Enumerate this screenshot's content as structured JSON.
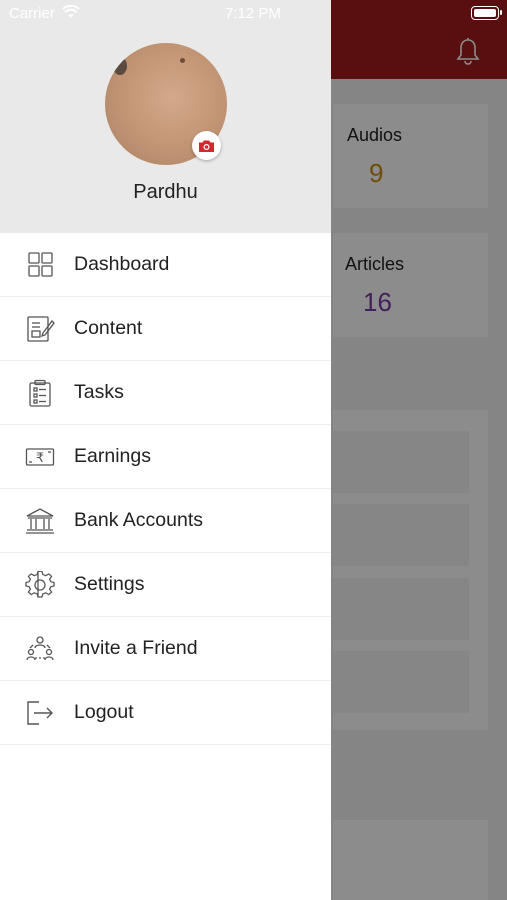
{
  "status_bar": {
    "carrier": "Carrier",
    "time": "7:12 PM"
  },
  "drawer": {
    "user_name": "Pardhu",
    "items": [
      {
        "label": "Dashboard",
        "icon": "dashboard-icon"
      },
      {
        "label": "Content",
        "icon": "content-icon"
      },
      {
        "label": "Tasks",
        "icon": "tasks-icon"
      },
      {
        "label": "Earnings",
        "icon": "earnings-icon"
      },
      {
        "label": "Bank Accounts",
        "icon": "bank-icon"
      },
      {
        "label": "Settings",
        "icon": "gear-icon"
      },
      {
        "label": "Invite a Friend",
        "icon": "invite-icon"
      },
      {
        "label": "Logout",
        "icon": "logout-icon"
      }
    ]
  },
  "background": {
    "audios_label": "Audios",
    "audios_value": "9",
    "articles_label": "Articles",
    "articles_value": "16"
  },
  "colors": {
    "header_red": "#a31c1c",
    "audios_accent": "#c98a12",
    "articles_accent": "#7a3aa8",
    "camera_red": "#d9262c"
  }
}
